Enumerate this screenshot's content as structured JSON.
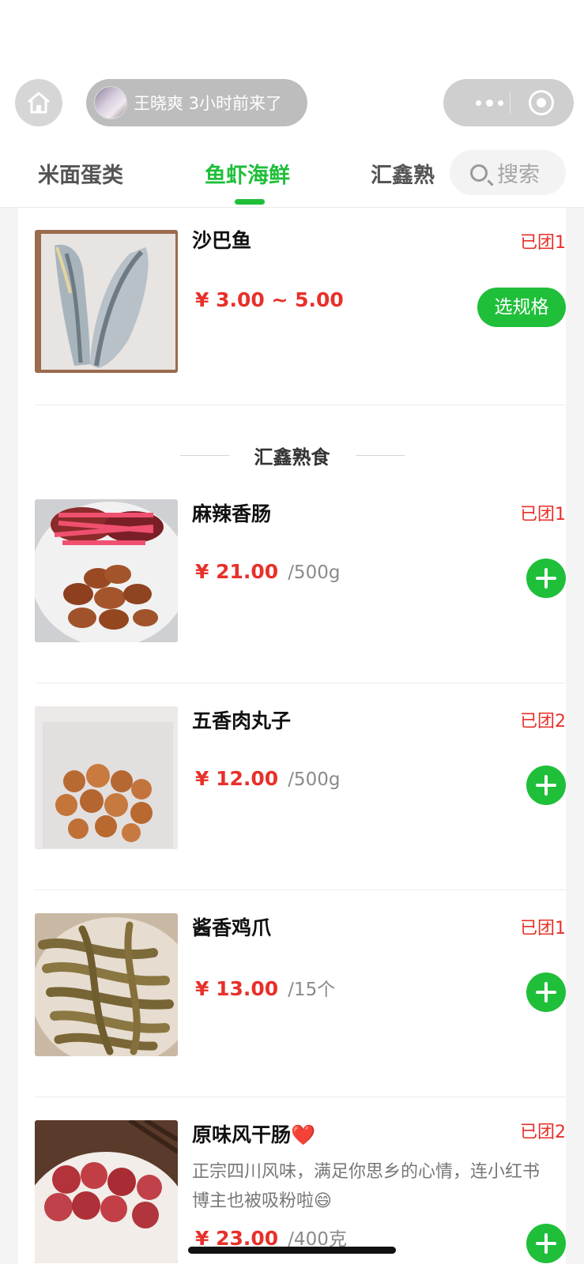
{
  "header": {
    "visitor_text": "王晓爽 3小时前来了"
  },
  "tabs": [
    {
      "label": "米面蛋类",
      "active": false
    },
    {
      "label": "鱼虾海鲜",
      "active": true
    },
    {
      "label": "汇鑫熟",
      "active": false
    }
  ],
  "search": {
    "placeholder": "搜索"
  },
  "colors": {
    "accent": "#1fbf3a",
    "price": "#e8302a"
  },
  "items": [
    {
      "name": "沙巴鱼",
      "sold": "已团1",
      "price": "¥ 3.00 ~ 5.00",
      "unit": "",
      "action": "选规格"
    },
    {
      "name": "麻辣香肠",
      "sold": "已团1",
      "price": "¥ 21.00",
      "unit": "/500g",
      "action": "add"
    },
    {
      "name": "五香肉丸子",
      "sold": "已团2",
      "price": "¥ 12.00",
      "unit": "/500g",
      "action": "add"
    },
    {
      "name": "酱香鸡爪",
      "sold": "已团1",
      "price": "¥ 13.00",
      "unit": "/15个",
      "action": "add"
    },
    {
      "name": "原味风干肠❤️",
      "sold": "已团2",
      "description": "正宗四川风味，满足你思乡的心情，连小红书博主也被吸粉啦😄",
      "price": "¥ 23.00",
      "unit": "/400克",
      "action": "add"
    }
  ],
  "section": {
    "title": "汇鑫熟食"
  }
}
